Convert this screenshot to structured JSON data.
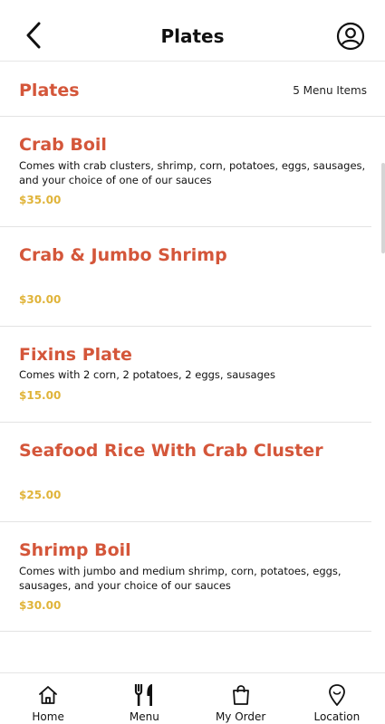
{
  "header": {
    "title": "Plates",
    "back_icon": "chevron-left-icon",
    "account_icon": "user-circle-icon"
  },
  "section": {
    "title": "Plates",
    "count": "5 Menu Items"
  },
  "items": [
    {
      "name": "Crab Boil",
      "description": "Comes with crab clusters, shrimp, corn, potatoes, eggs, sausages, and your choice of one of our sauces",
      "price": "$35.00"
    },
    {
      "name": "Crab & Jumbo Shrimp",
      "description": "",
      "price": "$30.00"
    },
    {
      "name": "Fixins Plate",
      "description": "Comes with 2 corn, 2 potatoes, 2 eggs, sausages",
      "price": "$15.00"
    },
    {
      "name": "Seafood Rice With Crab Cluster",
      "description": "",
      "price": "$25.00"
    },
    {
      "name": "Shrimp Boil",
      "description": "Comes with jumbo and medium shrimp, corn, potatoes, eggs, sausages, and your choice of our sauces",
      "price": "$30.00"
    }
  ],
  "nav": [
    {
      "label": "Home",
      "icon": "home-icon"
    },
    {
      "label": "Menu",
      "icon": "fork-knife-icon"
    },
    {
      "label": "My Order",
      "icon": "shopping-bag-icon"
    },
    {
      "label": "Location",
      "icon": "location-pin-icon"
    }
  ],
  "colors": {
    "accent": "#d4563a",
    "price": "#e0b43a"
  }
}
